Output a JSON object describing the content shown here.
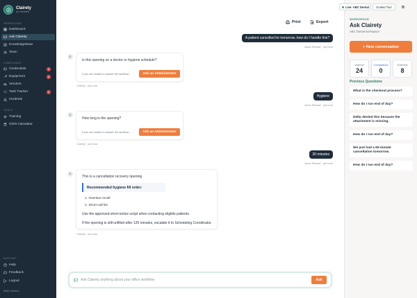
{
  "brand": {
    "name": "Clairety",
    "sub": "by Clairelink"
  },
  "sidebar": {
    "sections": {
      "operations": "OPERATIONS",
      "compliance": "COMPLIANCE",
      "tools": "TOOLS",
      "support": "SUPPORT"
    },
    "items": [
      {
        "label": "Dashboard",
        "icon": "grid-icon"
      },
      {
        "label": "Ask Clairety",
        "icon": "chat-icon",
        "active": true
      },
      {
        "label": "Knowledgebase",
        "icon": "book-icon"
      },
      {
        "label": "Team",
        "icon": "users-icon"
      },
      {
        "label": "Credentials",
        "icon": "id-card-icon",
        "badge": "1"
      },
      {
        "label": "Equipment",
        "icon": "wrench-icon",
        "badge": "1"
      },
      {
        "label": "Vendors",
        "icon": "truck-icon"
      },
      {
        "label": "Task Tracker",
        "icon": "checklist-icon",
        "badge": "1"
      },
      {
        "label": "Incidents",
        "icon": "alert-icon"
      },
      {
        "label": "Training",
        "icon": "graduation-icon"
      },
      {
        "label": "OON Calculator",
        "icon": "calculator-icon"
      },
      {
        "label": "Help",
        "icon": "help-icon"
      },
      {
        "label": "Feedback",
        "icon": "feedback-icon"
      },
      {
        "label": "Logout",
        "icon": "logout-icon"
      }
    ],
    "web_version": "Web Version"
  },
  "toolbar": {
    "print": "Print",
    "export": "Export"
  },
  "chat": {
    "user1": {
      "text": "A patient cancelled for tomorrow..how do I handle this?",
      "meta": "Jason Stewart · just now"
    },
    "bot1": {
      "avatar": "C",
      "text": "Is this opening on a doctor or hygiene schedule?",
      "sub": "If you are unable to answer the question:",
      "button": "Ask an Administrator",
      "meta": "Clairety · just now"
    },
    "user2": {
      "text": "Hygiene",
      "meta": "Jason Stewart · just now"
    },
    "bot2": {
      "avatar": "C",
      "text": "How long is the opening?",
      "sub": "If you are unable to answer the question:",
      "button": "Ask an Administrator",
      "meta": "Clairety · just now"
    },
    "user3": {
      "text": "30 minutes",
      "meta": "Jason Stewart · just now"
    },
    "bot3": {
      "avatar": "C",
      "intro": "This is a cancellation recovery opening.",
      "highlight": "Recommended hygiene fill order:",
      "list": [
        "1. Overdue recall",
        "2. Short-call list"
      ],
      "p1": "Use the approved short-notice script when contacting eligible patients.",
      "p2": "If the opening is still unfilled after 120 minutes, escalate it to Scheduling Coordinator.",
      "meta": "Clairety · just now"
    }
  },
  "input": {
    "placeholder": "Ask Clairety anything about your office workflow",
    "button": "Ask"
  },
  "panel": {
    "live": "Live: ABC Dental",
    "tour": "Guided Tour",
    "ws_label": "WORKSPACE",
    "title": "Ask Clairety",
    "sub": "ABC Dental workspace",
    "new_conv": "+ New conversation",
    "stats": [
      {
        "label": "Internal",
        "value": "24"
      },
      {
        "label": "Compliance",
        "value": "0"
      },
      {
        "label": "External",
        "value": "8"
      }
    ],
    "prev_title": "Previous Questions",
    "prev": [
      "What is the checkout process?",
      "How do I run end of day?",
      "Delta denied this because the attachment is missing.",
      "How do I run end of day?",
      "We just had a 90-minute cancellation tomorrow.",
      "How do I run end of day?"
    ]
  },
  "colors": {
    "sidebar": "#1d2b38",
    "accent": "#ef7d3c",
    "teal": "#2f8f7c",
    "user_bubble": "#1f2d3a",
    "badge": "#e04848"
  }
}
